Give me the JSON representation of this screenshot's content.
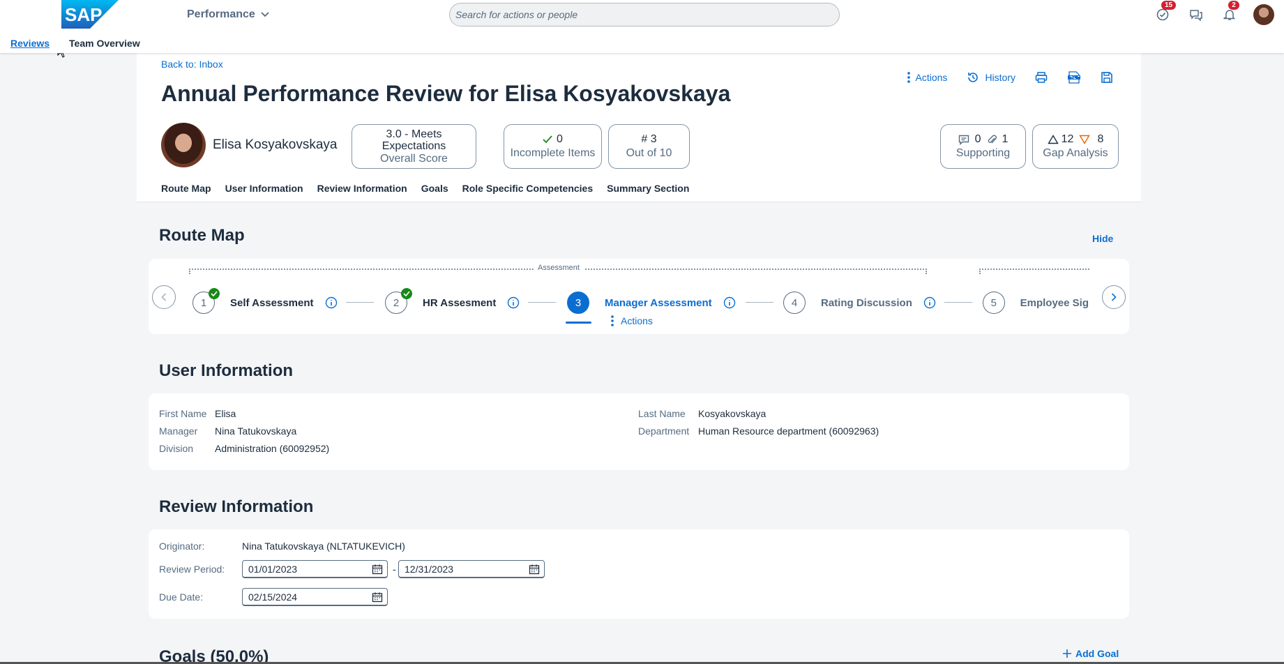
{
  "shell": {
    "app_title": "Performance",
    "search_placeholder": "Search for actions or people",
    "badges": {
      "tasks": "15",
      "notifications": "2"
    },
    "subnav": {
      "reviews": "Reviews",
      "team_overview": "Team Overview"
    },
    "logo_text": "SAP"
  },
  "header": {
    "back_link": "Back to: Inbox",
    "title": "Annual Performance Review for Elisa Kosyakovskaya",
    "actions_label": "Actions",
    "history_label": "History",
    "person_name": "Elisa Kosyakovskaya",
    "kpis": {
      "score_value_line1": "3.0 - Meets",
      "score_value_line2": "Expectations",
      "score_label": "Overall Score",
      "incomplete_value": "0",
      "incomplete_label": "Incomplete Items",
      "step_value": "# 3",
      "step_label": "Out of 10",
      "comments_count": "0",
      "attachments_count": "1",
      "supporting_label": "Supporting",
      "gap_up": "12",
      "gap_down": "8",
      "gap_label": "Gap Analysis"
    },
    "tabs": [
      "Route Map",
      "User Information",
      "Review Information",
      "Goals",
      "Role Specific Competencies",
      "Summary Section"
    ]
  },
  "route_map": {
    "title": "Route Map",
    "hide_label": "Hide",
    "phase_label": "Assessment",
    "steps": [
      {
        "num": "1",
        "label": "Self Assessment"
      },
      {
        "num": "2",
        "label": "HR Assesment"
      },
      {
        "num": "3",
        "label": "Manager Assessment"
      },
      {
        "num": "4",
        "label": "Rating Discussion"
      },
      {
        "num": "5",
        "label": "Employee Sig"
      }
    ],
    "step_actions_label": "Actions"
  },
  "user_info": {
    "title": "User Information",
    "first_name_label": "First Name",
    "first_name": "Elisa",
    "manager_label": "Manager",
    "manager": "Nina Tatukovskaya",
    "division_label": "Division",
    "division": "Administration (60092952)",
    "last_name_label": "Last Name",
    "last_name": "Kosyakovskaya",
    "department_label": "Department",
    "department": "Human Resource department (60092963)"
  },
  "review_info": {
    "title": "Review Information",
    "originator_label": "Originator:",
    "originator": "Nina Tatukovskaya (NLTATUKEVICH)",
    "period_label": "Review Period:",
    "period_start": "01/01/2023",
    "period_sep": "-",
    "period_end": "12/31/2023",
    "due_label": "Due Date:",
    "due_date": "02/15/2024"
  },
  "goals": {
    "title": "Goals (50.0%)",
    "add_goal_label": "Add Goal"
  },
  "colors": {
    "accent": "#0a6ed1",
    "text": "#1d2d3e",
    "muted": "#556b82",
    "positive": "#188918",
    "badge": "#d32030",
    "background": "#f4f5f7"
  }
}
